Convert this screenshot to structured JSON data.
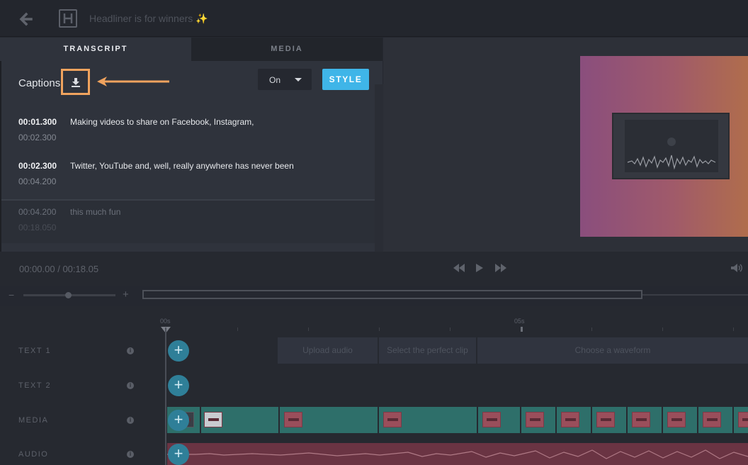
{
  "project": {
    "title": "Headliner is for winners",
    "sparkle": "✨"
  },
  "tabs": {
    "transcript": "TRANSCRIPT",
    "media": "MEDIA"
  },
  "captions": {
    "label": "Captions",
    "toggle_value": "On",
    "style_button": "STYLE",
    "rows": [
      {
        "start": "00:01.300",
        "end": "00:02.300",
        "text": "Making videos to share on Facebook, Instagram,"
      },
      {
        "start": "00:02.300",
        "end": "00:04.200",
        "text": "Twitter, YouTube and, well, really anywhere has never been"
      },
      {
        "start": "00:04.200",
        "end": "00:18.050",
        "text": "this much fun"
      }
    ]
  },
  "transport": {
    "timecode": "00:00.00 / 00:18.05"
  },
  "ruler": {
    "labels": [
      "00s",
      "05s"
    ]
  },
  "tracks": [
    {
      "label": "TEXT 1"
    },
    {
      "label": "TEXT 2"
    },
    {
      "label": "MEDIA"
    },
    {
      "label": "AUDIO"
    }
  ],
  "text_blocks": [
    {
      "label": "Upload audio"
    },
    {
      "label": "Select the perfect clip"
    },
    {
      "label": "Choose a waveform"
    }
  ],
  "colors": {
    "accent": "#3fb5e8",
    "highlight": "#f0a35e",
    "add_button": "#2f7f98",
    "media_clip": "#2e6f6a",
    "audio_clip": "#6a3443"
  },
  "icons": [
    "back-arrow-icon",
    "logo-icon",
    "download-icon",
    "rewind-icon",
    "play-icon",
    "fast-forward-icon",
    "volume-icon",
    "info-icon",
    "add-icon"
  ]
}
